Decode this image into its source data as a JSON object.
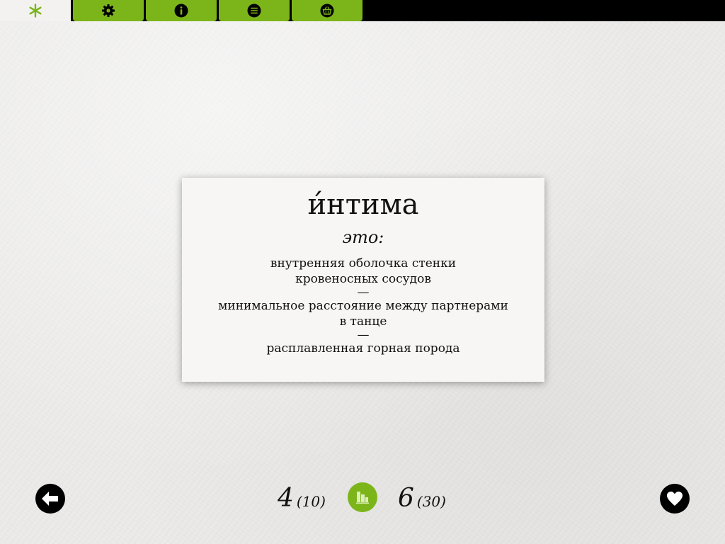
{
  "tabs": [
    {
      "name": "home",
      "icon": "asterisk-icon",
      "active": true
    },
    {
      "name": "settings",
      "icon": "gear-icon",
      "active": false
    },
    {
      "name": "info",
      "icon": "info-icon",
      "active": false
    },
    {
      "name": "list",
      "icon": "list-icon",
      "active": false
    },
    {
      "name": "basket",
      "icon": "basket-icon",
      "active": false
    }
  ],
  "colors": {
    "accent": "#7cb51a",
    "bar": "#000000",
    "card": "#f7f6f4"
  },
  "card": {
    "word": "и́нтима",
    "eto": "это:",
    "definitions": [
      {
        "lines": [
          "внутренняя оболочка стенки",
          "кровеносных сосудов"
        ]
      },
      {
        "lines": [
          "минимальное расстояние между партнерами",
          "в танце"
        ]
      },
      {
        "lines": [
          "расплавленная горная порода"
        ]
      }
    ],
    "separator": "—"
  },
  "footer": {
    "left_score": "4",
    "left_total": "(10)",
    "right_score": "6",
    "right_total": "(30)",
    "back_icon": "arrow-left-icon",
    "stats_icon": "bar-chart-icon",
    "favorite_icon": "heart-icon"
  }
}
